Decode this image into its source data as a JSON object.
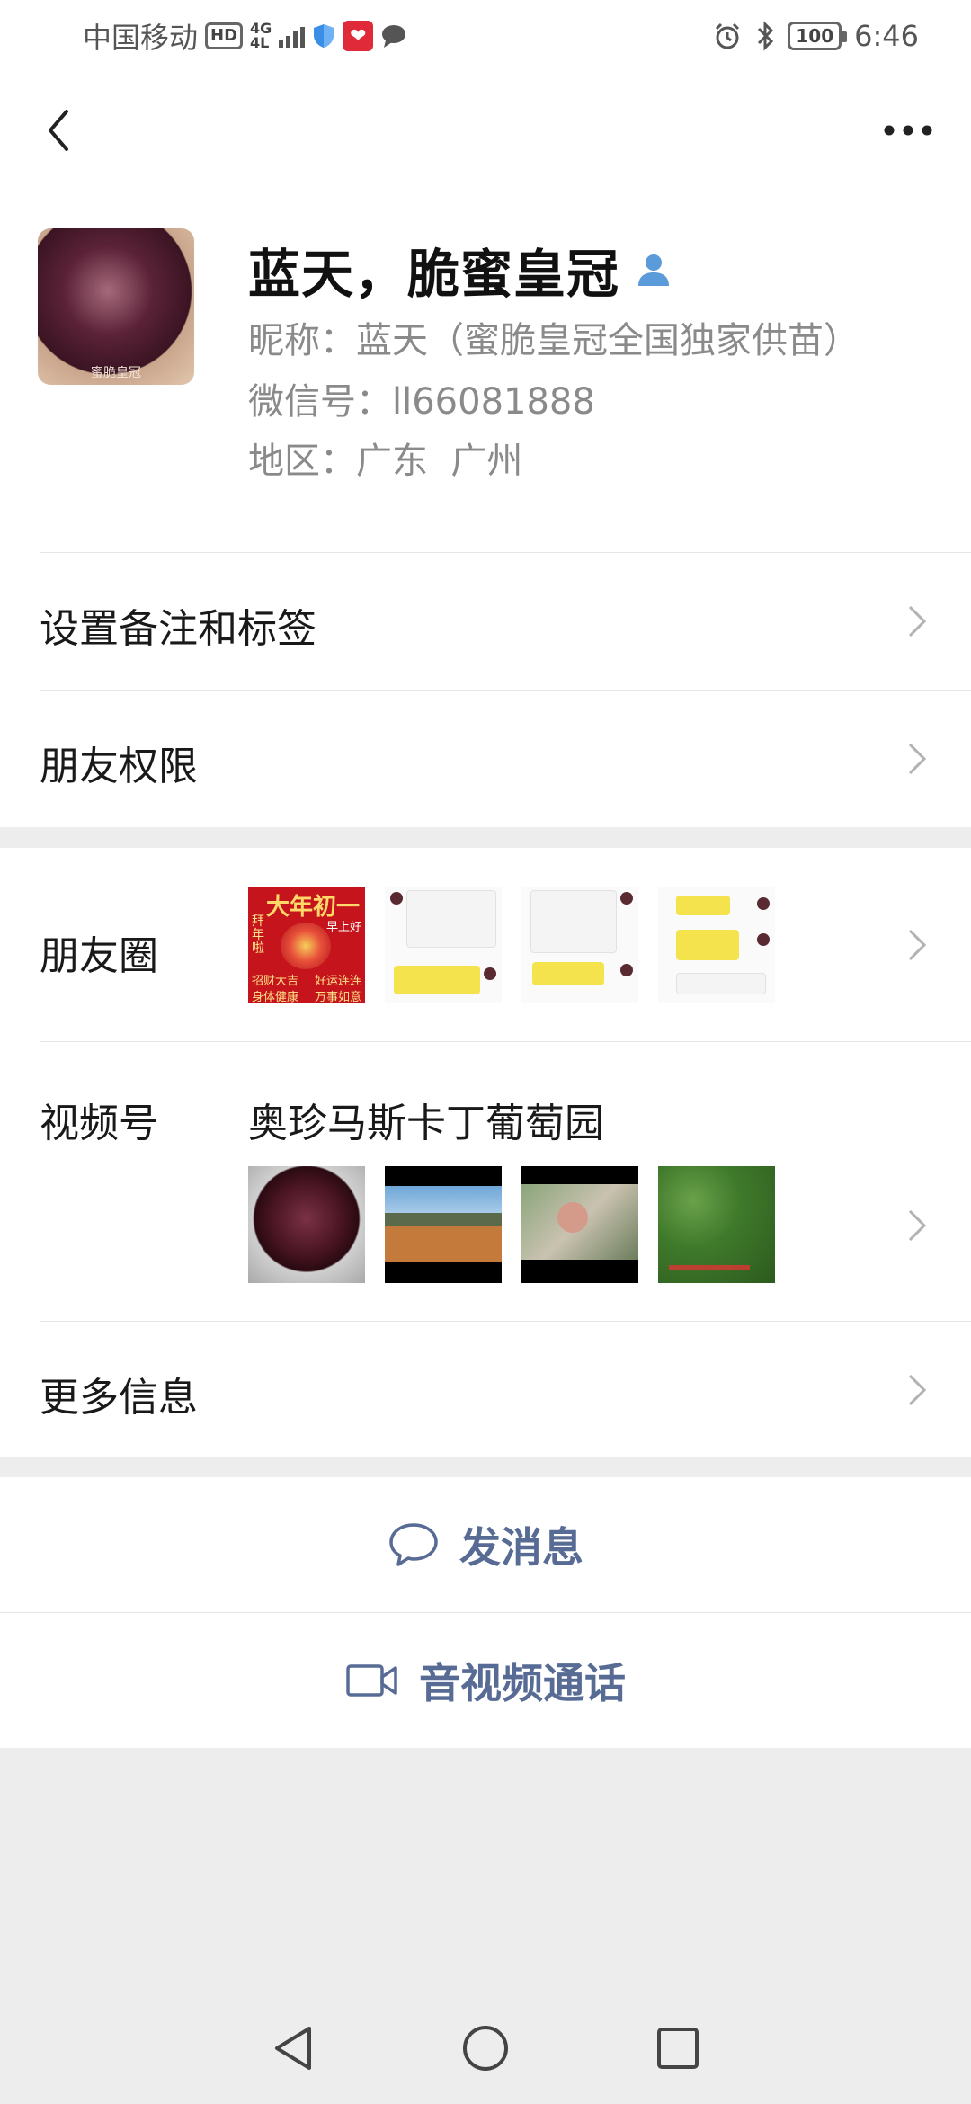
{
  "status_bar": {
    "carrier": "中国移动",
    "hd_badge": "HD",
    "network_type": "4G",
    "network_sub": "4L",
    "battery": "100",
    "time": "6:46"
  },
  "profile": {
    "name": "蓝天，脆蜜皇冠",
    "nickname": "昵称：蓝天（蜜脆皇冠全国独家供苗）",
    "wechat_id": "微信号：ll66081888",
    "region": "地区：广东  广州",
    "avatar_watermark": "蜜脆皇冠"
  },
  "rows": {
    "remark_tags": "设置备注和标签",
    "friend_permissions": "朋友权限",
    "moments": "朋友圈",
    "channels": "视频号",
    "channels_name": "奥珍马斯卡丁葡萄园",
    "more_info": "更多信息"
  },
  "moments_thumb1": {
    "line1": "大年初一",
    "line2": "早上好",
    "side": "拜年啦",
    "left_text": "招财大吉",
    "right_text": "好运连连",
    "bottom_left": "身体健康",
    "bottom_right": "万事如意"
  },
  "actions": {
    "send_message": "发消息",
    "video_call": "音视频通话"
  },
  "colors": {
    "link_blue": "#576b95",
    "page_bg": "#ededed",
    "verify_blue": "#4a90e2"
  }
}
